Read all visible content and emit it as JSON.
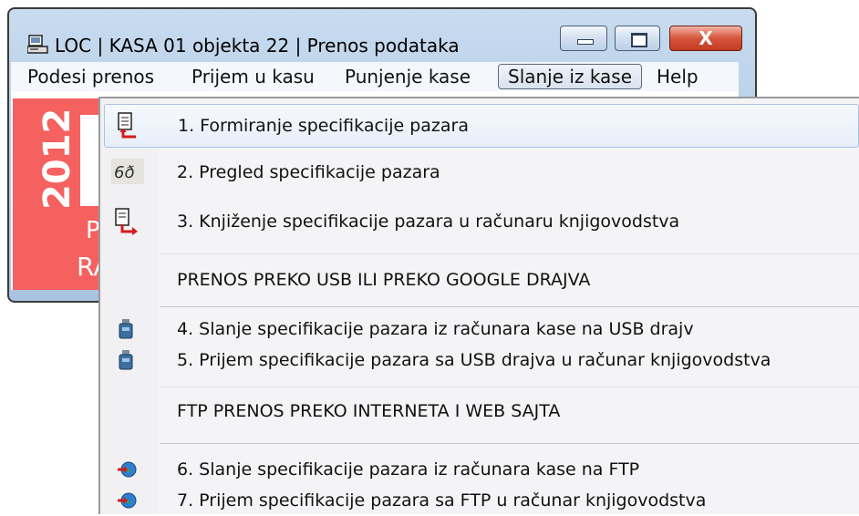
{
  "window": {
    "title": "LOC |  KASA 01 objekta 22 | Prenos podataka",
    "close_glyph": "X"
  },
  "menubar": {
    "items": [
      {
        "label": "Podesi prenos"
      },
      {
        "label": "Prijem u kasu"
      },
      {
        "label": "Punjenje kase"
      },
      {
        "label": "Slanje iz kase",
        "active": true
      },
      {
        "label": "Help"
      }
    ]
  },
  "banner": {
    "year": "2012",
    "text_a": "P",
    "text_b": "RA",
    "color": "#f4615f"
  },
  "dropdown": {
    "items": [
      {
        "label": "1. Formiranje specifikacije pazara",
        "icon": "document-red-arrow-icon",
        "highlighted": true
      },
      {
        "label": "2. Pregled specifikacije pazara",
        "icon": "glasses-icon"
      },
      {
        "label": "3. Knjiženje specifikacije pazara u računaru knjigovodstva",
        "icon": "document-export-icon"
      },
      {
        "label": "PRENOS PREKO USB ILI PREKO GOOGLE DRAJVA",
        "section_header": true
      },
      {
        "label": "4. Slanje specifikacije pazara iz računara kase na USB drajv",
        "icon": "usb-drive-icon"
      },
      {
        "label": "5. Prijem specifikacije pazara sa USB drajva u računar knjigovodstva",
        "icon": "usb-drive-icon"
      },
      {
        "label": "FTP PRENOS PREKO INTERNETA I WEB SAJTA",
        "section_header": true
      },
      {
        "label": "6. Slanje specifikacije pazara iz računara kase na FTP",
        "icon": "globe-arrow-icon"
      },
      {
        "label": "7. Prijem specifikacije pazara sa FTP u računar knjigovodstva",
        "icon": "globe-arrow-icon"
      }
    ]
  }
}
